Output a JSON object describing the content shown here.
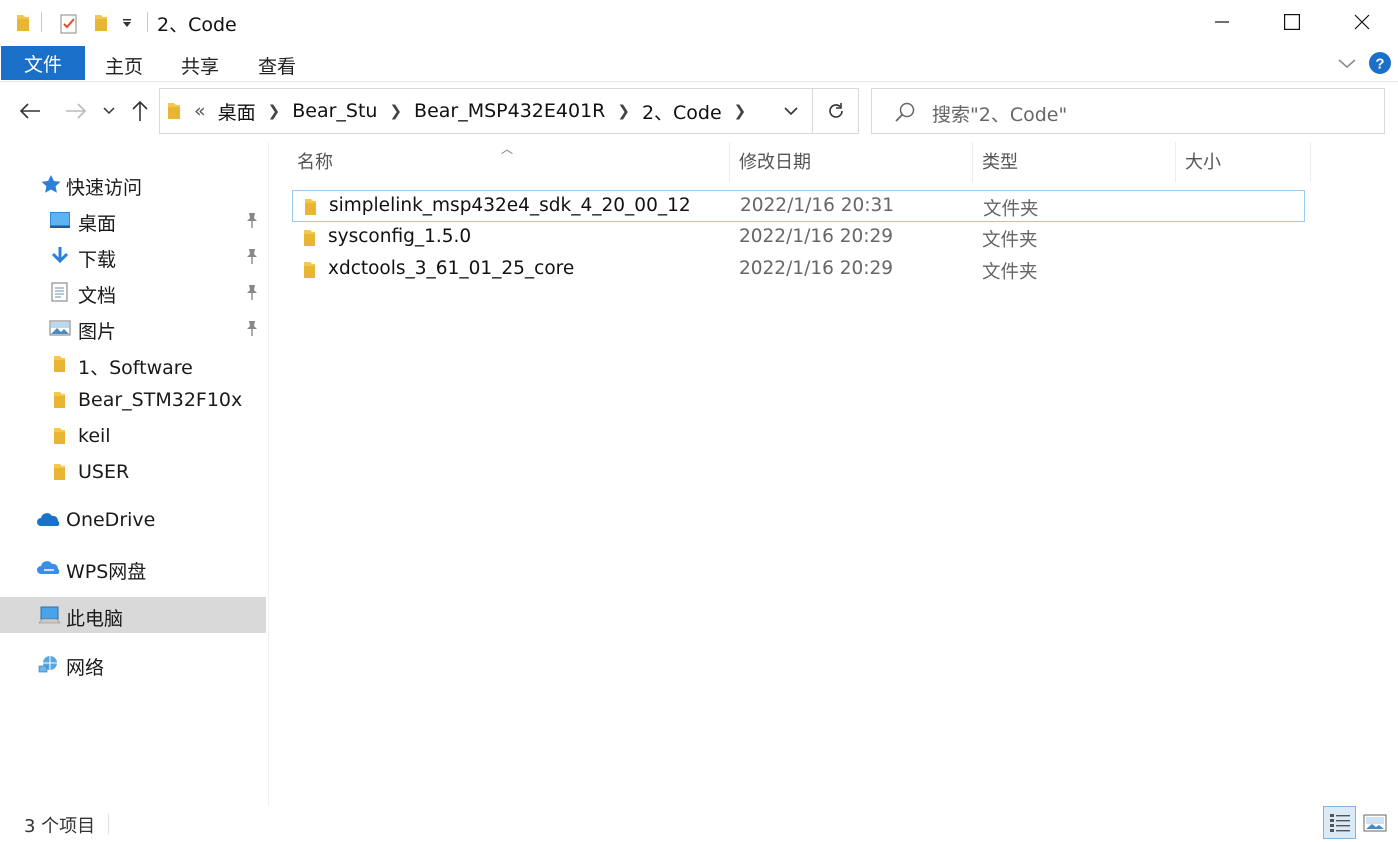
{
  "window": {
    "title": "2、Code",
    "minimize_icon": "minimize-icon",
    "maximize_icon": "maximize-icon",
    "close_icon": "close-icon"
  },
  "ribbon": {
    "file_tab": "文件",
    "tabs": [
      "主页",
      "共享",
      "查看"
    ]
  },
  "address": {
    "overflow": "«",
    "crumbs": [
      "桌面",
      "Bear_Stu",
      "Bear_MSP432E401R",
      "2、Code"
    ]
  },
  "search": {
    "placeholder": "搜索\"2、Code\""
  },
  "nav": {
    "quick_access": "快速访问",
    "pinned": [
      "桌面",
      "下载",
      "文档",
      "图片"
    ],
    "folders": [
      "1、Software",
      "Bear_STM32F10x",
      "keil",
      "USER"
    ],
    "onedrive": "OneDrive",
    "wps": "WPS网盘",
    "this_pc": "此电脑",
    "network": "网络"
  },
  "columns": {
    "name": "名称",
    "modified": "修改日期",
    "type": "类型",
    "size": "大小"
  },
  "files": [
    {
      "name": "simplelink_msp432e4_sdk_4_20_00_12",
      "modified": "2022/1/16 20:31",
      "type": "文件夹",
      "size": ""
    },
    {
      "name": "sysconfig_1.5.0",
      "modified": "2022/1/16 20:29",
      "type": "文件夹",
      "size": ""
    },
    {
      "name": "xdctools_3_61_01_25_core",
      "modified": "2022/1/16 20:29",
      "type": "文件夹",
      "size": ""
    }
  ],
  "status": {
    "item_count": "3 个项目"
  },
  "colors": {
    "accent": "#1a6fc9",
    "folder": "#f5c84c",
    "selection_border": "#99c9ef"
  }
}
